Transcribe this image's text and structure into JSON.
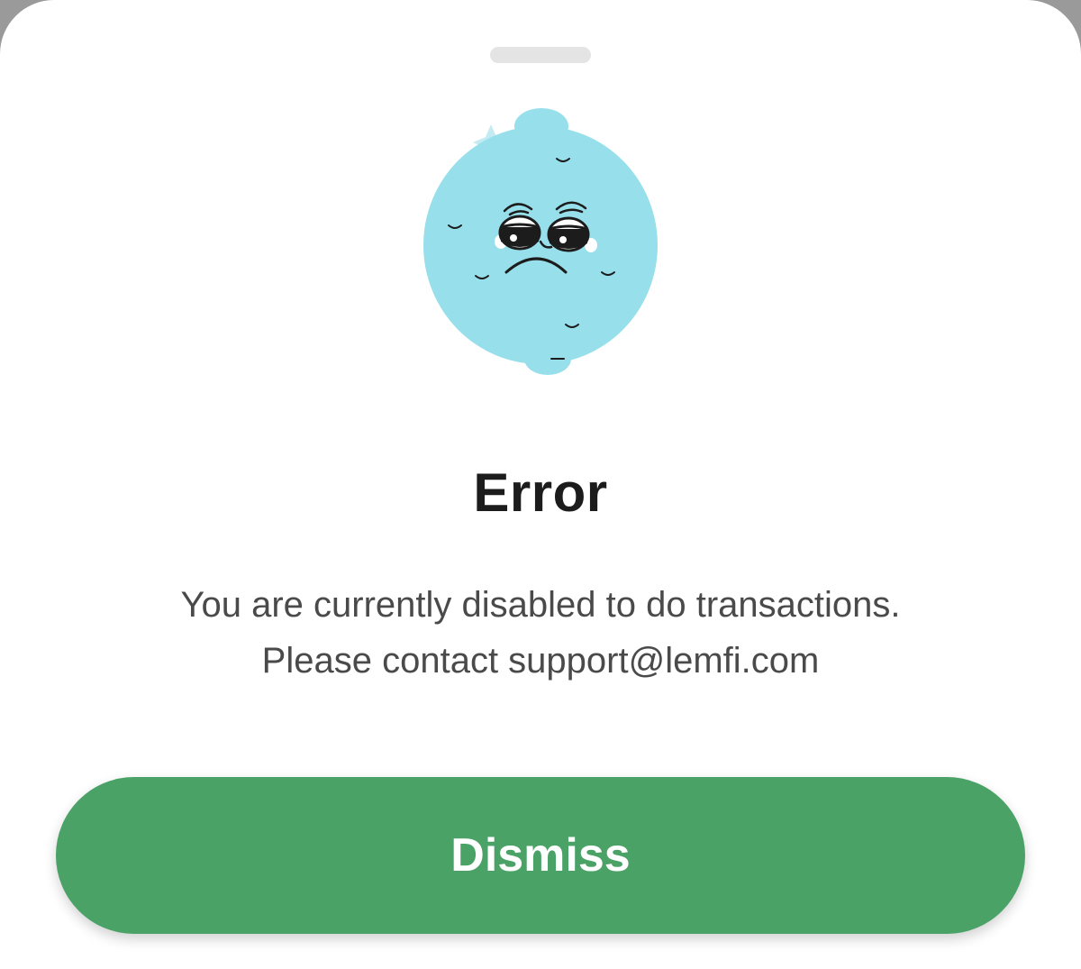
{
  "dialog": {
    "title": "Error",
    "message_line_1": "You are currently disabled to do transactions.",
    "message_line_2": "Please contact support@lemfi.com",
    "dismiss_label": "Dismiss"
  },
  "illustration": {
    "icon": "sad-lime-mascot-icon",
    "sparkle_icon": "sparkle-icon"
  },
  "colors": {
    "accent": "#4aa267",
    "mascot": "#97dfeb",
    "title": "#1c1c1c",
    "body_text": "#4a4a4a"
  }
}
